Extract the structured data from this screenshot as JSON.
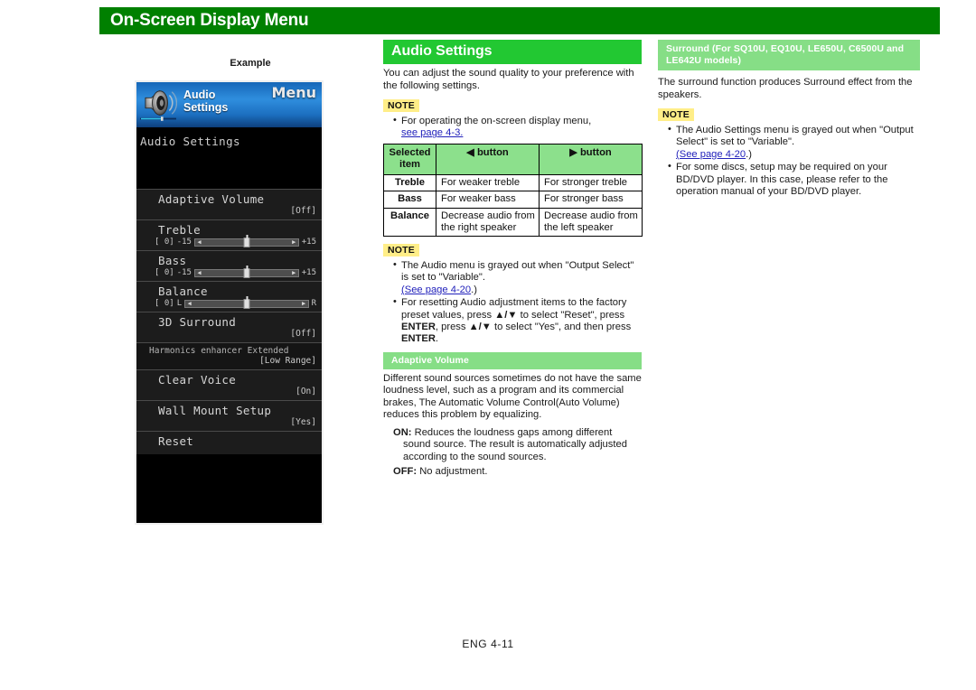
{
  "header": {
    "title": "On-Screen Display Menu",
    "bar_color": "#008000"
  },
  "left": {
    "example_label": "Example",
    "osd": {
      "banner": {
        "icon": "speaker-icon",
        "title_line1": "Audio",
        "title_line2": "Settings",
        "menu_label": "Menu"
      },
      "page_title": "Audio Settings",
      "rows": [
        {
          "label": "Adaptive Volume",
          "value": "[Off]",
          "type": "value"
        },
        {
          "label": "Treble",
          "type": "slider",
          "bracket": "[   0]",
          "min": "-15",
          "max": "+15"
        },
        {
          "label": "Bass",
          "type": "slider",
          "bracket": "[   0]",
          "min": "-15",
          "max": "+15"
        },
        {
          "label": "Balance",
          "type": "slider",
          "bracket": "[   0]",
          "min": "L",
          "max": "R"
        },
        {
          "label": "3D Surround",
          "value": "[Off]",
          "type": "value"
        },
        {
          "label": "Harmonics enhancer Extended",
          "value": "[Low Range]",
          "type": "value-small"
        },
        {
          "label": "Clear Voice",
          "value": "[On]",
          "type": "value"
        },
        {
          "label": "Wall Mount Setup",
          "value": "[Yes]",
          "type": "value"
        },
        {
          "label": "Reset",
          "value": "",
          "type": "plain"
        }
      ]
    }
  },
  "middle": {
    "section_title": "Audio Settings",
    "intro": "You can adjust the sound quality to your preference with the following settings.",
    "note1": {
      "badge": "NOTE",
      "items": [
        {
          "text": "For operating the on-screen display menu,",
          "link": "see page 4-3.",
          "tail": ""
        }
      ]
    },
    "table": {
      "headers": [
        "Selected item",
        "◀ button",
        "▶ button"
      ],
      "header_col1_line1": "Selected",
      "header_col1_line2": "item",
      "header_col2": "button",
      "header_col3": "button",
      "header_col2_icon": "◀",
      "header_col3_icon": "▶",
      "rows": [
        {
          "item": "Treble",
          "left": "For weaker treble",
          "right": "For stronger treble"
        },
        {
          "item": "Bass",
          "left": "For weaker bass",
          "right": "For stronger bass"
        },
        {
          "item": "Balance",
          "left": "Decrease audio from the right speaker",
          "right": "Decrease audio from the left speaker"
        }
      ]
    },
    "note2": {
      "badge": "NOTE",
      "item1_a": "The Audio menu is grayed out when \"Output Select\" is set to \"Variable\".",
      "item1_link": "(See page 4-20",
      "item1_tail": ".)",
      "item2_a": "For resetting Audio adjustment items to the factory preset values, press ",
      "item2_arrows1": "▲/▼",
      "item2_b": " to select \"Reset\", press ",
      "item2_enter1": "ENTER",
      "item2_c": ", press ",
      "item2_arrows2": "▲/▼",
      "item2_d": " to select \"Yes\", and then press ",
      "item2_enter2": "ENTER",
      "item2_e": "."
    },
    "adaptive": {
      "section_title": "Adaptive Volume",
      "body": "Different sound sources sometimes do not have the same loudness level, such as a program and its commercial brakes, The Automatic Volume Control(Auto Volume) reduces this problem by equalizing.",
      "on_key": "ON:",
      "on_text": " Reduces the loudness gaps among different sound source. The result is automatically adjusted according to the sound sources.",
      "off_key": "OFF:",
      "off_text": " No adjustment."
    }
  },
  "right": {
    "section_title": "Surround (For SQ10U, EQ10U, LE650U, C6500U and LE642U models)",
    "body": "The surround function produces Surround effect from the speakers.",
    "note": {
      "badge": "NOTE",
      "item1_a": "The Audio Settings menu is grayed out when \"Output Select\" is set to \"Variable\".",
      "item1_link": "(See page 4-20",
      "item1_tail": ".)",
      "item2": "For some discs, setup may be required on your BD/DVD player. In this case, please refer to the operation manual of your BD/DVD player."
    }
  },
  "footer": {
    "page_ref": "ENG 4-11"
  },
  "colors": {
    "title_green": "#008000",
    "section_green": "#22c832",
    "subsection_green": "#86de86",
    "table_header_green": "#8ce08c",
    "note_yellow": "#ffee88",
    "link_blue": "#2222bb"
  }
}
